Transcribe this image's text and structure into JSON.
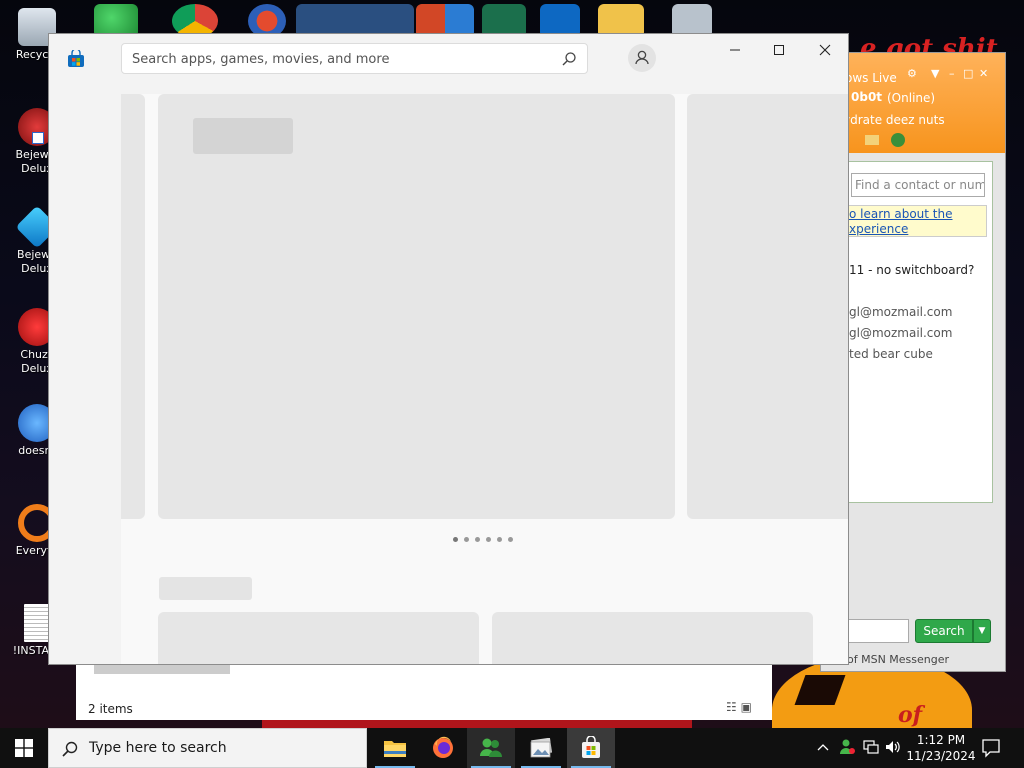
{
  "desktop": {
    "icons": [
      {
        "lines": [
          "Recycle"
        ]
      },
      {
        "lines": [
          "Bejewel",
          "Delux"
        ]
      },
      {
        "lines": [
          "Bejewe",
          "Delux"
        ]
      },
      {
        "lines": [
          "Chuzz",
          "Delux"
        ]
      },
      {
        "lines": [
          "doesnt"
        ]
      },
      {
        "lines": [
          "Everyth"
        ]
      },
      {
        "lines": [
          "!INSTALL"
        ]
      }
    ],
    "graffiti_top": "e got shit",
    "graffiti_bottom": "of"
  },
  "messenger": {
    "title": "ows Live",
    "name": "0b0t",
    "status": "(Online)",
    "psm": "ydrate deez nuts",
    "find_placeholder": "Find a contact or number",
    "info_line1": "o learn about the",
    "info_line2": "xperience",
    "group": "11 - no switchboard?",
    "contacts": [
      "gl@mozmail.com",
      "gl@mozmail.com",
      "ted bear cube"
    ],
    "search_label": "Search",
    "footer": "of MSN Messenger"
  },
  "explorer": {
    "item_count": "2 items"
  },
  "store": {
    "search_placeholder": "Search apps, games, movies, and more",
    "pager_count": 6
  },
  "taskbar": {
    "search_text": "Type here to search",
    "time": "1:12 PM",
    "date": "11/23/2024"
  },
  "colors": {
    "taskbar_bg": "#101010",
    "store_bg": "#f3f3f3",
    "messenger_accent": "#f7941d",
    "msn_search_green": "#2fa84a",
    "running_indicator": "#76b9ed"
  }
}
